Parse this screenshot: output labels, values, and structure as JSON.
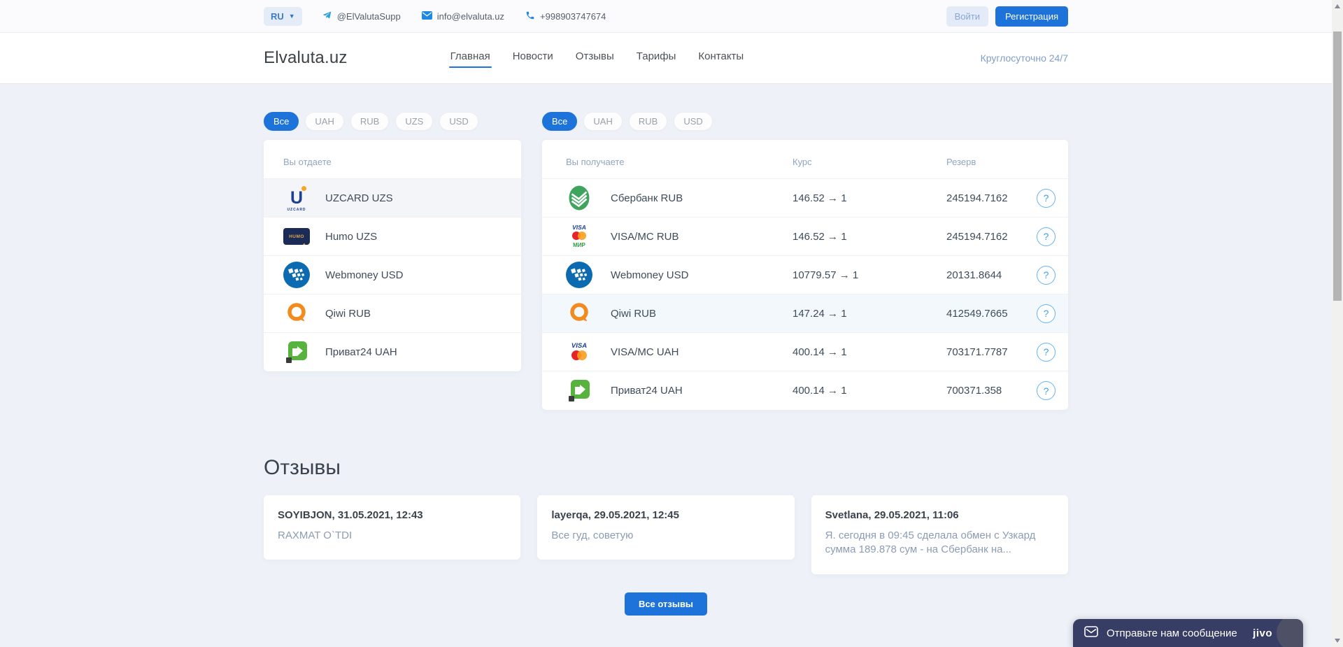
{
  "colors": {
    "primary": "#1d73d9",
    "chat_bg": "#383d66"
  },
  "topbar": {
    "lang": "RU",
    "contacts": [
      {
        "icon": "telegram-icon",
        "label": "@ElValutaSupp"
      },
      {
        "icon": "email-icon",
        "label": "info@elvaluta.uz"
      },
      {
        "icon": "phone-icon",
        "label": "+998903747674"
      }
    ],
    "login_label": "Войти",
    "register_label": "Регистрация"
  },
  "header": {
    "logo": "Elvaluta.uz",
    "nav": [
      {
        "label": "Главная",
        "active": true
      },
      {
        "label": "Новости",
        "active": false
      },
      {
        "label": "Отзывы",
        "active": false
      },
      {
        "label": "Тарифы",
        "active": false
      },
      {
        "label": "Контакты",
        "active": false
      }
    ],
    "schedule": "Круглосуточно 24/7"
  },
  "exchange": {
    "give": {
      "filters": [
        "Все",
        "UAH",
        "RUB",
        "UZS",
        "USD"
      ],
      "active_filter": "Все",
      "column_title": "Вы отдаете",
      "items": [
        {
          "icon": "uzcard-icon",
          "label": "UZCARD UZS",
          "selected": true
        },
        {
          "icon": "humo-icon",
          "label": "Humo UZS",
          "selected": false
        },
        {
          "icon": "webmoney-icon",
          "label": "Webmoney USD",
          "selected": false
        },
        {
          "icon": "qiwi-icon",
          "label": "Qiwi RUB",
          "selected": false
        },
        {
          "icon": "privat24-icon",
          "label": "Приват24 UAH",
          "selected": false
        }
      ]
    },
    "get": {
      "filters": [
        "Все",
        "UAH",
        "RUB",
        "USD"
      ],
      "active_filter": "Все",
      "columns": {
        "name": "Вы получаете",
        "rate": "Курс",
        "reserve": "Резерв"
      },
      "help_symbol": "?",
      "rows": [
        {
          "icon": "sberbank-icon",
          "label": "Сбербанк RUB",
          "rate": "146.52 → 1",
          "reserve": "245194.7162",
          "highlighted": false
        },
        {
          "icon": "visa-mc-mir-icon",
          "label": "VISA/MC RUB",
          "rate": "146.52 → 1",
          "reserve": "245194.7162",
          "highlighted": false
        },
        {
          "icon": "webmoney-icon",
          "label": "Webmoney USD",
          "rate": "10779.57 → 1",
          "reserve": "20131.8644",
          "highlighted": false
        },
        {
          "icon": "qiwi-icon",
          "label": "Qiwi RUB",
          "rate": "147.24 → 1",
          "reserve": "412549.7665",
          "highlighted": true
        },
        {
          "icon": "visa-mc-icon",
          "label": "VISA/MC UAH",
          "rate": "400.14 → 1",
          "reserve": "703171.7787",
          "highlighted": false
        },
        {
          "icon": "privat24-icon",
          "label": "Приват24 UAH",
          "rate": "400.14 → 1",
          "reserve": "700371.358",
          "highlighted": false
        }
      ]
    }
  },
  "reviews": {
    "title": "Отзывы",
    "cards": [
      {
        "author": "SOYIBJON, 31.05.2021, 12:43",
        "text": "RAXMAT O`TDI"
      },
      {
        "author": "layerqa, 29.05.2021, 12:45",
        "text": "Все гуд, советую"
      },
      {
        "author": "Svetlana, 29.05.2021, 11:06",
        "text": "Я. сегодня в 09:45 сделала обмен с Узкард сумма 189.878 сум - на Сбербанк на..."
      }
    ],
    "all_button": "Все отзывы"
  },
  "chat": {
    "message": "Отправьте нам сообщение",
    "brand": "jivo"
  }
}
